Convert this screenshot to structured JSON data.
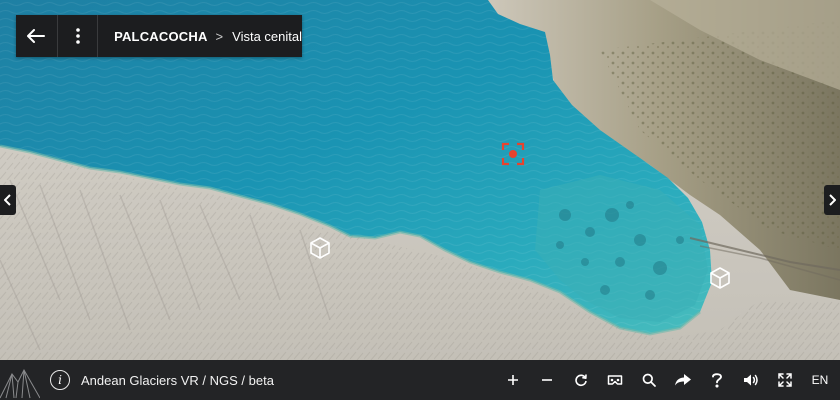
{
  "header": {
    "location": "PALCACOCHA",
    "separator": ">",
    "view": "Vista cenital"
  },
  "footer": {
    "info_glyph": "i",
    "title": "Andean Glaciers VR / NGS / beta",
    "language": "EN",
    "tools": [
      "zoom-in-icon",
      "zoom-out-icon",
      "autorotate-icon",
      "vr-headset-icon",
      "search-icon",
      "share-icon",
      "help-icon",
      "volume-icon",
      "fullscreen-icon"
    ]
  },
  "hotspots": [
    "3d-cube-icon",
    "3d-cube-icon",
    "target-marker-icon"
  ],
  "colors": {
    "lake_deep": "#1c8fae",
    "lake_shallow": "#3fb6bd",
    "shore": "#d9d6cf",
    "marker": "#e8432e",
    "bar": "#232426"
  }
}
